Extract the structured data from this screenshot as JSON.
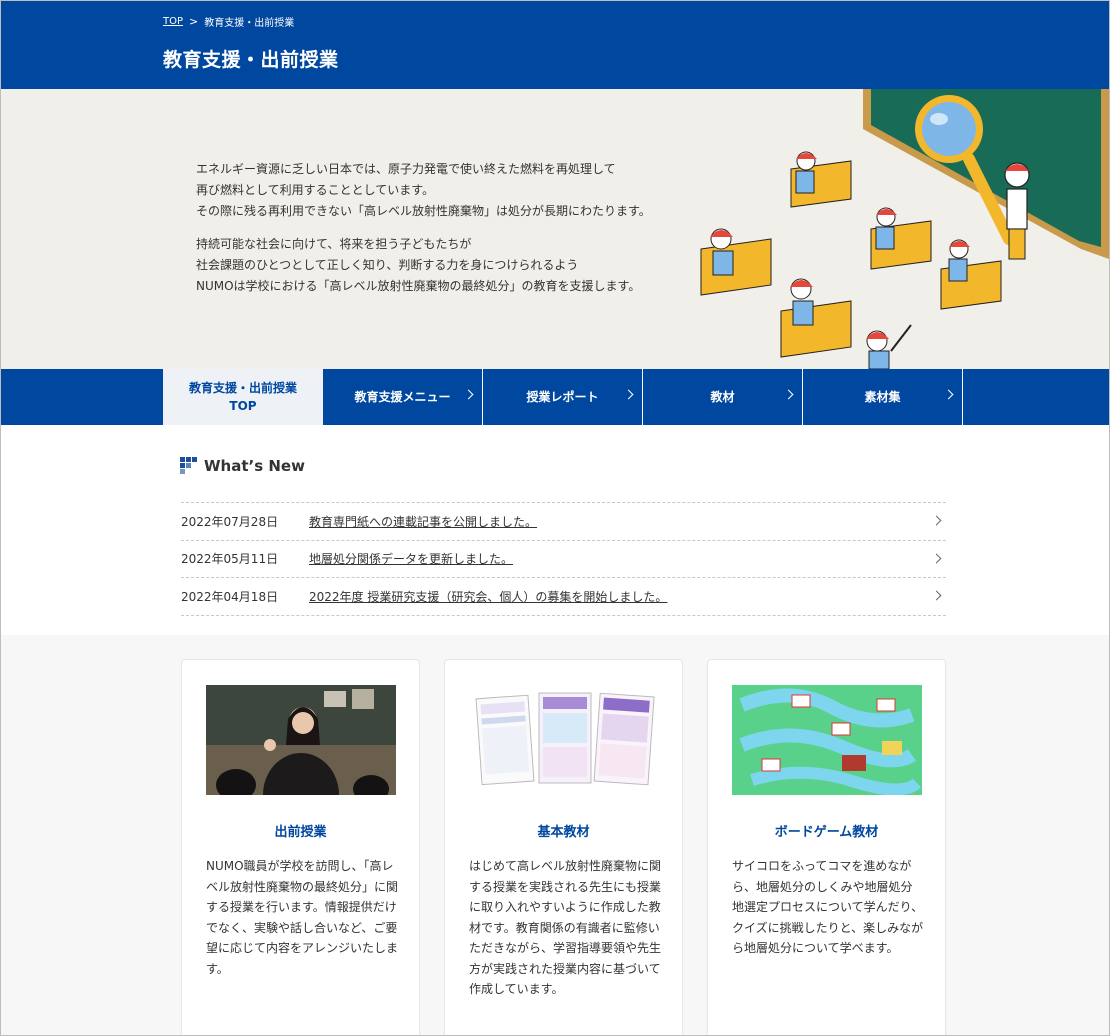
{
  "breadcrumb": {
    "top": "TOP",
    "current": "教育支援・出前授業"
  },
  "page_title": "教育支援・出前授業",
  "hero": {
    "paragraph1": [
      "エネルギー資源に乏しい日本では、原子力発電で使い終えた燃料を再処理して",
      "再び燃料として利用することとしています。",
      "その際に残る再利用できない「高レベル放射性廃棄物」は処分が長期にわたります。"
    ],
    "paragraph2": [
      "持続可能な社会に向けて、将来を担う子どもたちが",
      "社会課題のひとつとして正しく知り、判断する力を身につけられるよう",
      "NUMOは学校における「高レベル放射性廃棄物の最終処分」の教育を支援します。"
    ]
  },
  "nav": {
    "items": [
      {
        "label_line1": "教育支援・出前授業",
        "label_line2": "TOP"
      },
      {
        "label": "教育支援メニュー"
      },
      {
        "label": "授業レポート"
      },
      {
        "label": "教材"
      },
      {
        "label": "素材集"
      }
    ]
  },
  "whats_new": {
    "heading": "What’s New",
    "items": [
      {
        "date": "2022年07月28日",
        "title": "教育専門紙への連載記事を公開しました。"
      },
      {
        "date": "2022年05月11日",
        "title": "地層処分関係データを更新しました。"
      },
      {
        "date": "2022年04月18日",
        "title": "2022年度 授業研究支援（研究会、個人）の募集を開始しました。"
      }
    ]
  },
  "cards": [
    {
      "title": "出前授業",
      "desc": "NUMO職員が学校を訪問し、「高レベル放射性廃棄物の最終処分」に関する授業を行います。情報提供だけでなく、実験や話し合いなど、ご要望に応じて内容をアレンジいたします。"
    },
    {
      "title": "基本教材",
      "desc": "はじめて高レベル放射性廃棄物に関する授業を実践される先生にも授業に取り入れやすいように作成した教材です。教育関係の有識者に監修いただきながら、学習指導要領や先生方が実践された授業内容に基づいて作成しています。"
    },
    {
      "title": "ボードゲーム教材",
      "desc": "サイコロをふってコマを進めながら、地層処分のしくみや地層処分地選定プロセスについて学んだり、クイズに挑戦したりと、楽しみながら地層処分について学べます。"
    }
  ],
  "colors": {
    "primary": "#0047a0",
    "hero_bg": "#f1efe9",
    "accent": "#f3b72b"
  }
}
